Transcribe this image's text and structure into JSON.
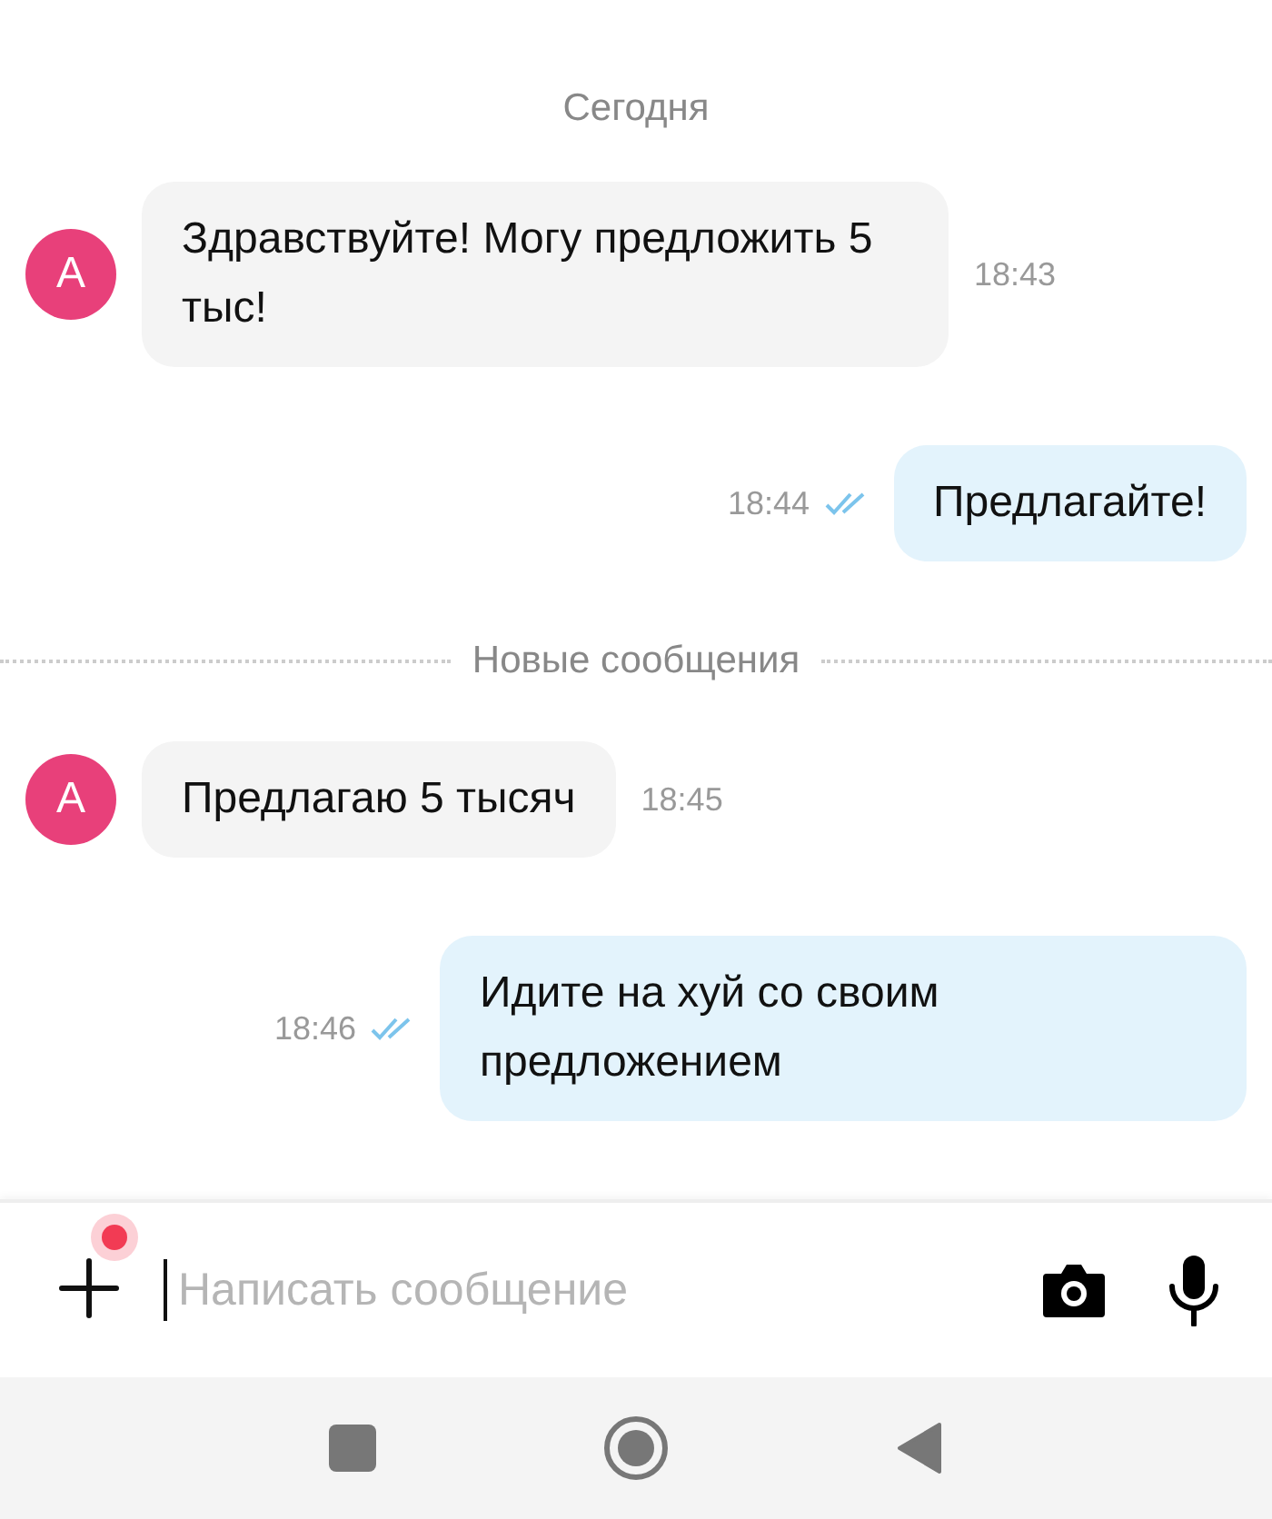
{
  "feed": [
    {
      "kind": "date",
      "text": "Сегодня"
    },
    {
      "kind": "incoming",
      "avatar": "А",
      "text": "Здравствуйте! Могу предложить 5 тыс!",
      "time": "18:43"
    },
    {
      "kind": "outgoing",
      "text": "Предлагайте!",
      "time": "18:44",
      "read": true
    },
    {
      "kind": "divider",
      "text": "Новые сообщения"
    },
    {
      "kind": "incoming",
      "avatar": "А",
      "text": "Предлагаю 5 тысяч",
      "time": "18:45"
    },
    {
      "kind": "outgoing",
      "text": "Идите на хуй со своим предложением",
      "time": "18:46",
      "read": true
    }
  ],
  "composer": {
    "attach_badge": true,
    "placeholder": "Написать сообщение"
  }
}
